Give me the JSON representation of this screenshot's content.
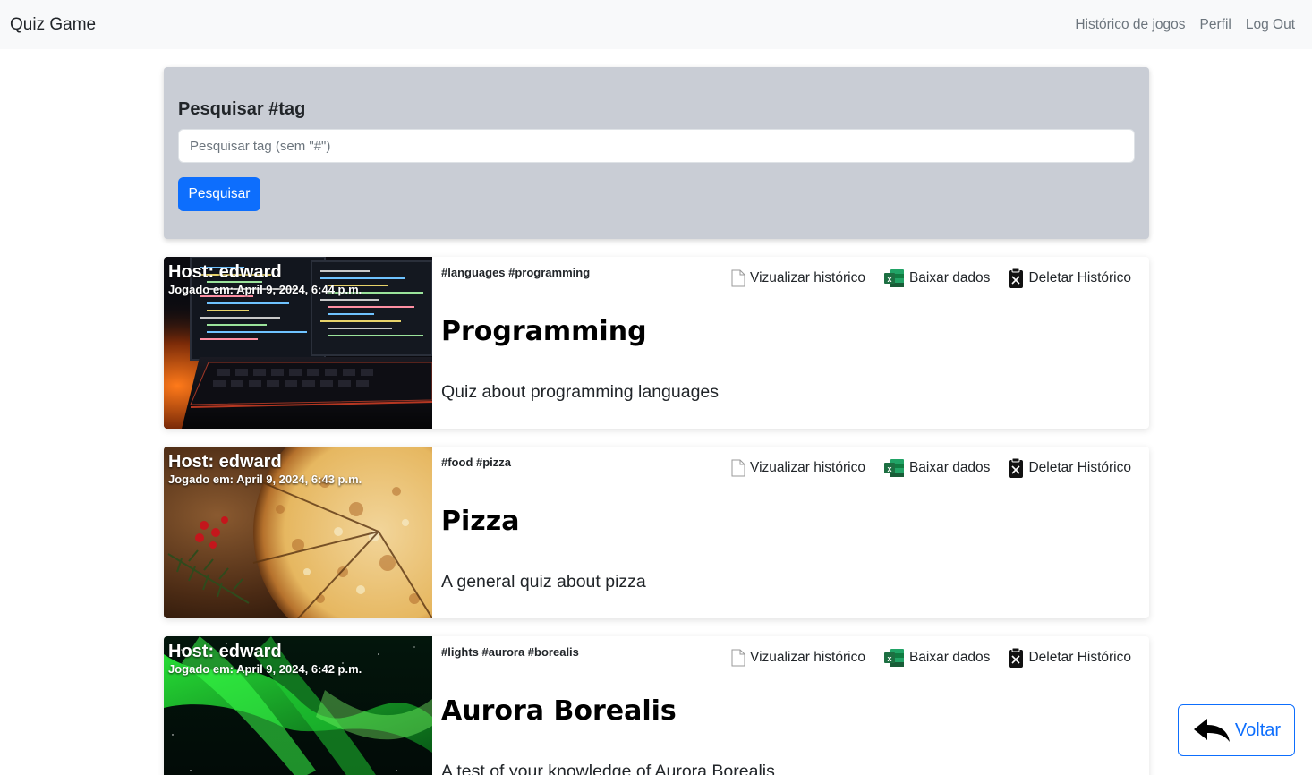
{
  "navbar": {
    "brand": "Quiz Game",
    "links": [
      "Histórico de jogos",
      "Perfil",
      "Log Out"
    ]
  },
  "search": {
    "title": "Pesquisar #tag",
    "placeholder": "Pesquisar tag (sem \"#\")",
    "button_label": "Pesquisar"
  },
  "actions": {
    "view": "Vizualizar histórico",
    "download": "Baixar dados",
    "delete": "Deletar Histórico"
  },
  "games": [
    {
      "host": "Host: edward",
      "played": "Jogado em: April 9, 2024, 6:44 p.m.",
      "tags": "#languages #programming",
      "title": "Programming",
      "description": "Quiz about programming languages",
      "image_icon": "computer-monitor-image"
    },
    {
      "host": "Host: edward",
      "played": "Jogado em: April 9, 2024, 6:43 p.m.",
      "tags": "#food #pizza",
      "title": "Pizza",
      "description": "A general quiz about pizza",
      "image_icon": "pizza-image"
    },
    {
      "host": "Host: edward",
      "played": "Jogado em: April 9, 2024, 6:42 p.m.",
      "tags": "#lights #aurora #borealis",
      "title": "Aurora Borealis",
      "description": "A test of your knowledge of Aurora Borealis",
      "image_icon": "aurora-image"
    }
  ],
  "back_button": {
    "label": "Voltar"
  },
  "colors": {
    "primary": "#0d6efd",
    "navbar_bg": "#f8f9fa",
    "search_panel_bg": "#c9cdd5",
    "excel_green": "#1d6f42"
  }
}
